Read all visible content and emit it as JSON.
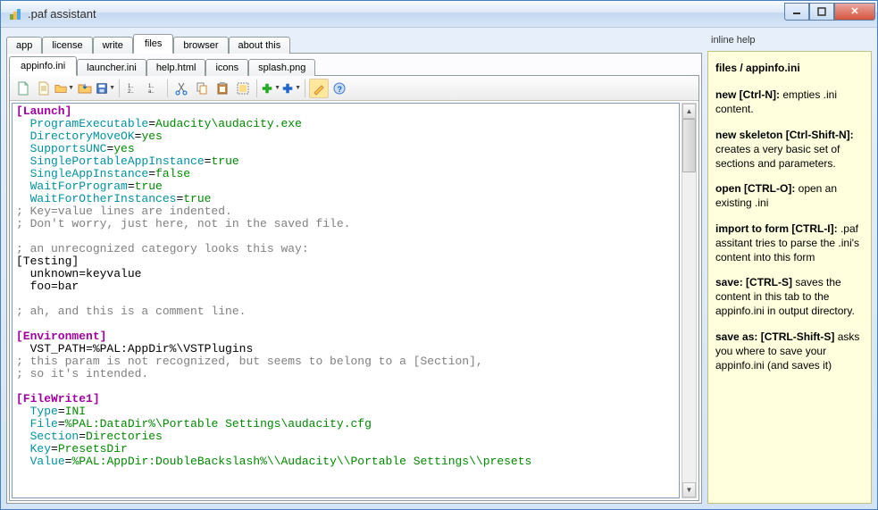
{
  "window": {
    "title": ".paf assistant"
  },
  "tabs1": [
    {
      "label": "app"
    },
    {
      "label": "license"
    },
    {
      "label": "write"
    },
    {
      "label": "files"
    },
    {
      "label": "browser"
    },
    {
      "label": "about this"
    }
  ],
  "tabs1_active": 3,
  "tabs2": [
    {
      "label": "appinfo.ini"
    },
    {
      "label": "launcher.ini"
    },
    {
      "label": "help.html"
    },
    {
      "label": "icons"
    },
    {
      "label": "splash.png"
    }
  ],
  "tabs2_active": 0,
  "editor": {
    "lines": [
      {
        "t": "sec",
        "text": "[Launch]"
      },
      {
        "indent": true,
        "key": "ProgramExecutable",
        "val": "Audacity\\audacity.exe"
      },
      {
        "indent": true,
        "key": "DirectoryMoveOK",
        "val": "yes"
      },
      {
        "indent": true,
        "key": "SupportsUNC",
        "val": "yes"
      },
      {
        "indent": true,
        "key": "SinglePortableAppInstance",
        "val": "true"
      },
      {
        "indent": true,
        "key": "SingleAppInstance",
        "val": "false"
      },
      {
        "indent": true,
        "key": "WaitForProgram",
        "val": "true"
      },
      {
        "indent": true,
        "key": "WaitForOtherInstances",
        "val": "true"
      },
      {
        "t": "com",
        "text": "; Key=value lines are indented."
      },
      {
        "t": "com",
        "text": "; Don't worry, just here, not in the saved file."
      },
      {
        "t": "blank"
      },
      {
        "t": "com",
        "text": "; an unrecognized category looks this way:"
      },
      {
        "t": "raw",
        "text": "[Testing]"
      },
      {
        "t": "raw",
        "text": "  unknown=keyvalue"
      },
      {
        "t": "raw",
        "text": "  foo=bar"
      },
      {
        "t": "blank"
      },
      {
        "t": "com",
        "text": "; ah, and this is a comment line."
      },
      {
        "t": "blank"
      },
      {
        "t": "sec",
        "text": "[Environment]"
      },
      {
        "t": "raw",
        "text": "  VST_PATH=%PAL:AppDir%\\VSTPlugins"
      },
      {
        "t": "com",
        "text": "; this param is not recognized, but seems to belong to a [Section],"
      },
      {
        "t": "com",
        "text": "; so it's intended."
      },
      {
        "t": "blank"
      },
      {
        "t": "sec",
        "text": "[FileWrite1]"
      },
      {
        "indent": true,
        "key": "Type",
        "val": "INI"
      },
      {
        "indent": true,
        "key": "File",
        "val": "%PAL:DataDir%\\Portable Settings\\audacity.cfg"
      },
      {
        "indent": true,
        "key": "Section",
        "val": "Directories"
      },
      {
        "indent": true,
        "key": "Key",
        "val": "PresetsDir"
      },
      {
        "indent": true,
        "key": "Value",
        "val": "%PAL:AppDir:DoubleBackslash%\\\\Audacity\\\\Portable Settings\\\\presets"
      }
    ]
  },
  "help": {
    "header": "inline help",
    "title": "files / appinfo.ini",
    "items": [
      {
        "b": "new [Ctrl-N]:",
        "t": " empties .ini content."
      },
      {
        "b": "new skeleton [Ctrl-Shift-N]:",
        "t": " creates a very basic set of sections and parameters."
      },
      {
        "b": "open [CTRL-O]:",
        "t": " open an existing .ini"
      },
      {
        "b": "import to form [CTRL-I]:",
        "t": " .paf assitant tries to parse the .ini's content into this form"
      },
      {
        "b": "save: [CTRL-S]",
        "t": " saves the content in this tab to the appinfo.ini in output directory."
      },
      {
        "b": "save as: [CTRL-Shift-S]",
        "t": " asks you where to save your appinfo.ini (and saves it)"
      }
    ]
  }
}
